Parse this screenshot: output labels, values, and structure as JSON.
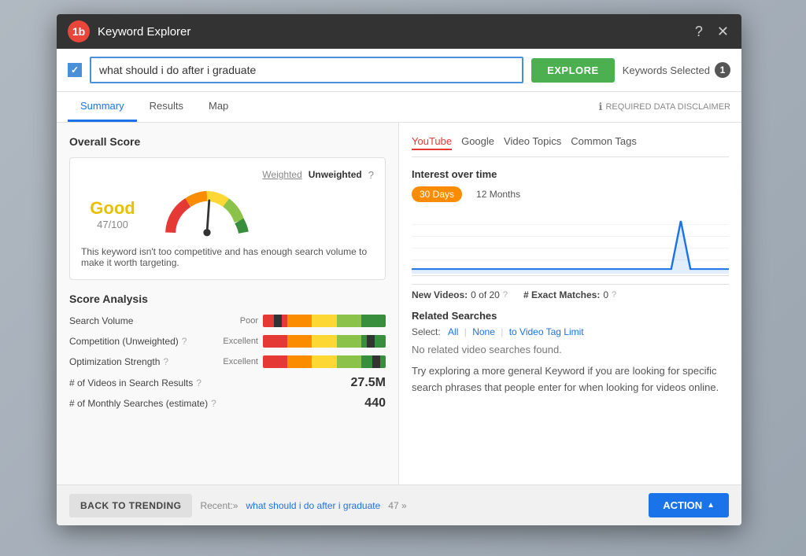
{
  "app": {
    "icon_label": "1b",
    "title": "Keyword Explorer"
  },
  "search": {
    "checkbox_checked": true,
    "input_value": "what should i do after i graduate",
    "explore_btn": "EXPLORE",
    "keywords_selected_label": "Keywords Selected",
    "keywords_selected_count": "1"
  },
  "tabs": [
    {
      "id": "summary",
      "label": "Summary",
      "active": true
    },
    {
      "id": "results",
      "label": "Results",
      "active": false
    },
    {
      "id": "map",
      "label": "Map",
      "active": false
    }
  ],
  "disclaimer": "REQUIRED DATA DISCLAIMER",
  "left_panel": {
    "overall_score_title": "Overall Score",
    "weighted_label": "Weighted",
    "unweighted_label": "Unweighted",
    "help_icon": "?",
    "score_grade": "Good",
    "score_value": "47/100",
    "score_desc": "This keyword isn't too competitive and has enough search volume to make it worth targeting.",
    "score_analysis_title": "Score Analysis",
    "rows": [
      {
        "label": "Search Volume",
        "has_help": false,
        "bar_label": "Poor",
        "marker_pct": 12
      },
      {
        "label": "Competition (Unweighted)",
        "has_help": true,
        "bar_label": "Excellent",
        "marker_pct": 88
      },
      {
        "label": "Optimization Strength",
        "has_help": true,
        "bar_label": "Excellent",
        "marker_pct": 92
      }
    ],
    "stats": [
      {
        "label": "# of Videos in Search Results",
        "has_help": true,
        "value": "27.5M"
      },
      {
        "label": "# of Monthly Searches (estimate)",
        "has_help": true,
        "value": "440"
      }
    ]
  },
  "right_panel": {
    "platform_tabs": [
      "YouTube",
      "Google",
      "Video Topics",
      "Common Tags"
    ],
    "active_platform": "YouTube",
    "interest_title": "Interest over time",
    "time_30": "30 Days",
    "time_12": "12 Months",
    "new_videos_label": "New Videos:",
    "new_videos_value": "0 of 20",
    "exact_matches_label": "# Exact Matches:",
    "exact_matches_value": "0",
    "related_title": "Related Searches",
    "select_label": "Select:",
    "select_all": "All",
    "select_none": "None",
    "select_limit": "to Video Tag Limit",
    "no_related": "No related video searches found.",
    "related_hint": "Try exploring a more general Keyword if you are looking for specific search phrases that people enter for when looking for videos online."
  },
  "footer": {
    "back_btn": "BACK TO TRENDING",
    "recent_label": "Recent:»",
    "recent_link": "what should i do after i graduate",
    "recent_count": "47 »",
    "action_btn": "ACTION"
  }
}
